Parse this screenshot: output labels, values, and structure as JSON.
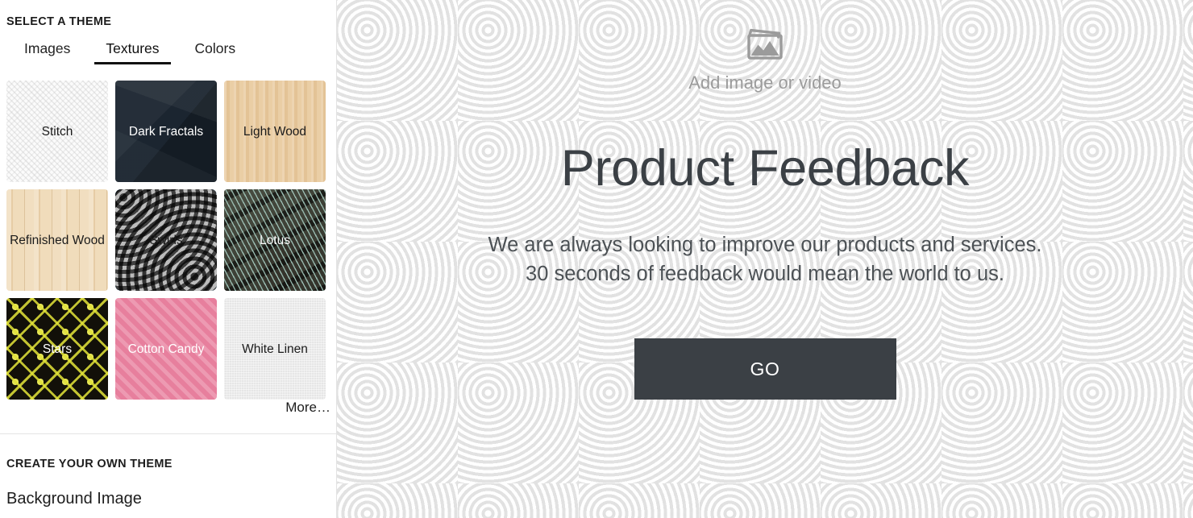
{
  "sidebar": {
    "panel_title": "SELECT A THEME",
    "tabs": [
      {
        "label": "Images",
        "active": false
      },
      {
        "label": "Textures",
        "active": true
      },
      {
        "label": "Colors",
        "active": false
      }
    ],
    "themes": [
      {
        "label": "Stitch",
        "texture": "stitch",
        "text": "dark",
        "selected": false
      },
      {
        "label": "Dark Fractals",
        "texture": "darkfractals",
        "text": "light",
        "selected": false
      },
      {
        "label": "Light Wood",
        "texture": "lightwood",
        "text": "dark",
        "selected": false
      },
      {
        "label": "Refinished Wood",
        "texture": "refinished",
        "text": "dark",
        "selected": false
      },
      {
        "label": "Swirls",
        "texture": "swirls",
        "text": "dark",
        "selected": true
      },
      {
        "label": "Lotus",
        "texture": "lotus",
        "text": "light",
        "selected": false
      },
      {
        "label": "Stars",
        "texture": "stars",
        "text": "light",
        "selected": false
      },
      {
        "label": "Cotton Candy",
        "texture": "cottoncandy",
        "text": "light",
        "selected": false
      },
      {
        "label": "White Linen",
        "texture": "whitelinen",
        "text": "dark",
        "selected": false
      }
    ],
    "more_label": "More…",
    "create_section_title": "CREATE YOUR OWN THEME",
    "background_image_label": "Background Image",
    "selected_border_color": "#2b95d6"
  },
  "preview": {
    "media_placeholder_label": "Add image or video",
    "media_icon": "image-icon",
    "headline": "Product Feedback",
    "description_line1": "We are always looking to improve our products and services.",
    "description_line2": "30 seconds of feedback would mean the world to us.",
    "go_label": "GO",
    "go_button_color": "#3b4045",
    "headline_color": "#3b4045",
    "placeholder_text_color": "#9b9b9b",
    "background_texture": "swirls"
  }
}
